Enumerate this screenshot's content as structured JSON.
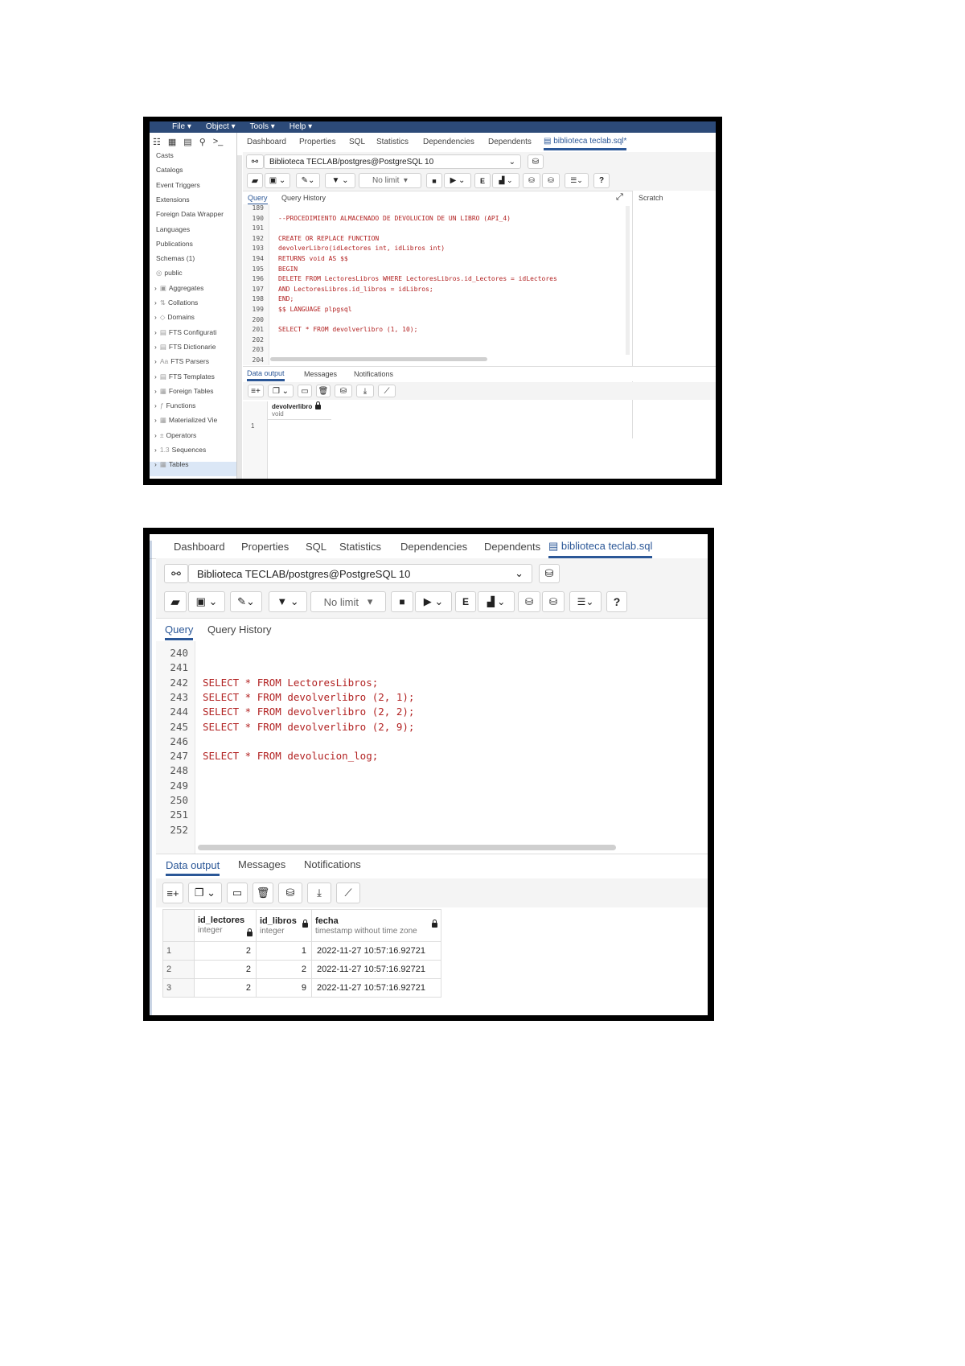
{
  "top": {
    "menu": [
      "File ▾",
      "Object ▾",
      "Tools ▾",
      "Help ▾"
    ],
    "tabs": [
      "Dashboard",
      "Properties",
      "SQL",
      "Statistics",
      "Dependencies",
      "Dependents",
      "biblioteca teclab.sql*"
    ],
    "connection": "Biblioteca TECLAB/postgres@PostgreSQL 10",
    "limit": "No limit",
    "editor_tabs": [
      "Query",
      "Query History"
    ],
    "scratch": "Scratch",
    "sidebar": [
      "Casts",
      "Catalogs",
      "Event Triggers",
      "Extensions",
      "Foreign Data Wrapper",
      "Languages",
      "Publications",
      "Schemas (1)",
      "public",
      "Aggregates",
      "Collations",
      "Domains",
      "FTS Configurati",
      "FTS Dictionarie",
      "FTS Parsers",
      "FTS Templates",
      "Foreign Tables",
      "Functions",
      "Materialized Vie",
      "Operators",
      "Sequences",
      "Tables"
    ],
    "line_numbers": [
      "189",
      "190",
      "191",
      "192",
      "193",
      "194",
      "195",
      "196",
      "197",
      "198",
      "199",
      "200",
      "201",
      "202",
      "203",
      "204"
    ],
    "code_lines": [
      "",
      "--PROCEDIMIENTO ALMACENADO DE DEVOLUCION DE UN LIBRO (API_4)",
      "",
      "CREATE OR REPLACE FUNCTION",
      "devolverLibro(idLectores int, idLibros int)",
      "RETURNS void AS $$",
      "BEGIN",
      "DELETE FROM LectoresLibros WHERE LectoresLibros.id_Lectores = idLectores",
      "AND LectoresLibros.id_libros = idLibros;",
      "END;",
      "$$ LANGUAGE plpgsql",
      "",
      "SELECT * FROM devolverlibro (1, 10);",
      "",
      "",
      ""
    ],
    "output_tabs": [
      "Data output",
      "Messages",
      "Notifications"
    ],
    "result_col": "devolverlibro",
    "result_type": "void",
    "result_row": "1"
  },
  "bottom": {
    "tabs": [
      "Dashboard",
      "Properties",
      "SQL",
      "Statistics",
      "Dependencies",
      "Dependents",
      "biblioteca teclab.sql"
    ],
    "connection": "Biblioteca TECLAB/postgres@PostgreSQL 10",
    "limit": "No limit",
    "editor_tabs": [
      "Query",
      "Query History"
    ],
    "line_numbers": [
      "240",
      "241",
      "242",
      "243",
      "244",
      "245",
      "246",
      "247",
      "248",
      "249",
      "250",
      "251",
      "252"
    ],
    "code_lines": [
      "",
      "",
      "SELECT * FROM LectoresLibros;",
      "SELECT * FROM devolverlibro (2, 1);",
      "SELECT * FROM devolverlibro (2, 2);",
      "SELECT * FROM devolverlibro (2, 9);",
      "",
      "SELECT * FROM devolucion_log;",
      "",
      "",
      "",
      "",
      ""
    ],
    "output_tabs": [
      "Data output",
      "Messages",
      "Notifications"
    ],
    "columns": [
      {
        "name": "id_lectores",
        "type": "integer"
      },
      {
        "name": "id_libros",
        "type": "integer"
      },
      {
        "name": "fecha",
        "type": "timestamp without time zone"
      }
    ],
    "rows": [
      {
        "n": "1",
        "id_lectores": "2",
        "id_libros": "1",
        "fecha": "2022-11-27 10:57:16.92721"
      },
      {
        "n": "2",
        "id_lectores": "2",
        "id_libros": "2",
        "fecha": "2022-11-27 10:57:16.92721"
      },
      {
        "n": "3",
        "id_lectores": "2",
        "id_libros": "9",
        "fecha": "2022-11-27 10:57:16.92721"
      }
    ]
  },
  "colors": {
    "accent": "#2b5797",
    "keyword": "#b22222",
    "frame": "#000000"
  }
}
